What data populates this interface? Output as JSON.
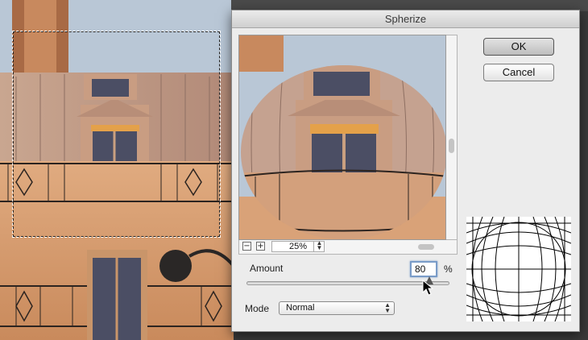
{
  "dialog": {
    "title": "Spherize",
    "ok_label": "OK",
    "cancel_label": "Cancel",
    "zoom": {
      "value": "25%",
      "minus_icon": "zoom-out-icon",
      "plus_icon": "zoom-in-icon"
    },
    "amount": {
      "label": "Amount",
      "value": "80",
      "unit": "%",
      "slider_min": -100,
      "slider_max": 100,
      "slider_value": 80
    },
    "mode": {
      "label": "Mode",
      "selected": "Normal"
    }
  },
  "colors": {
    "facade": "#d9a278",
    "roof": "#b99a8c",
    "sky": "#b9c7d6",
    "window": "#4b4e64"
  }
}
